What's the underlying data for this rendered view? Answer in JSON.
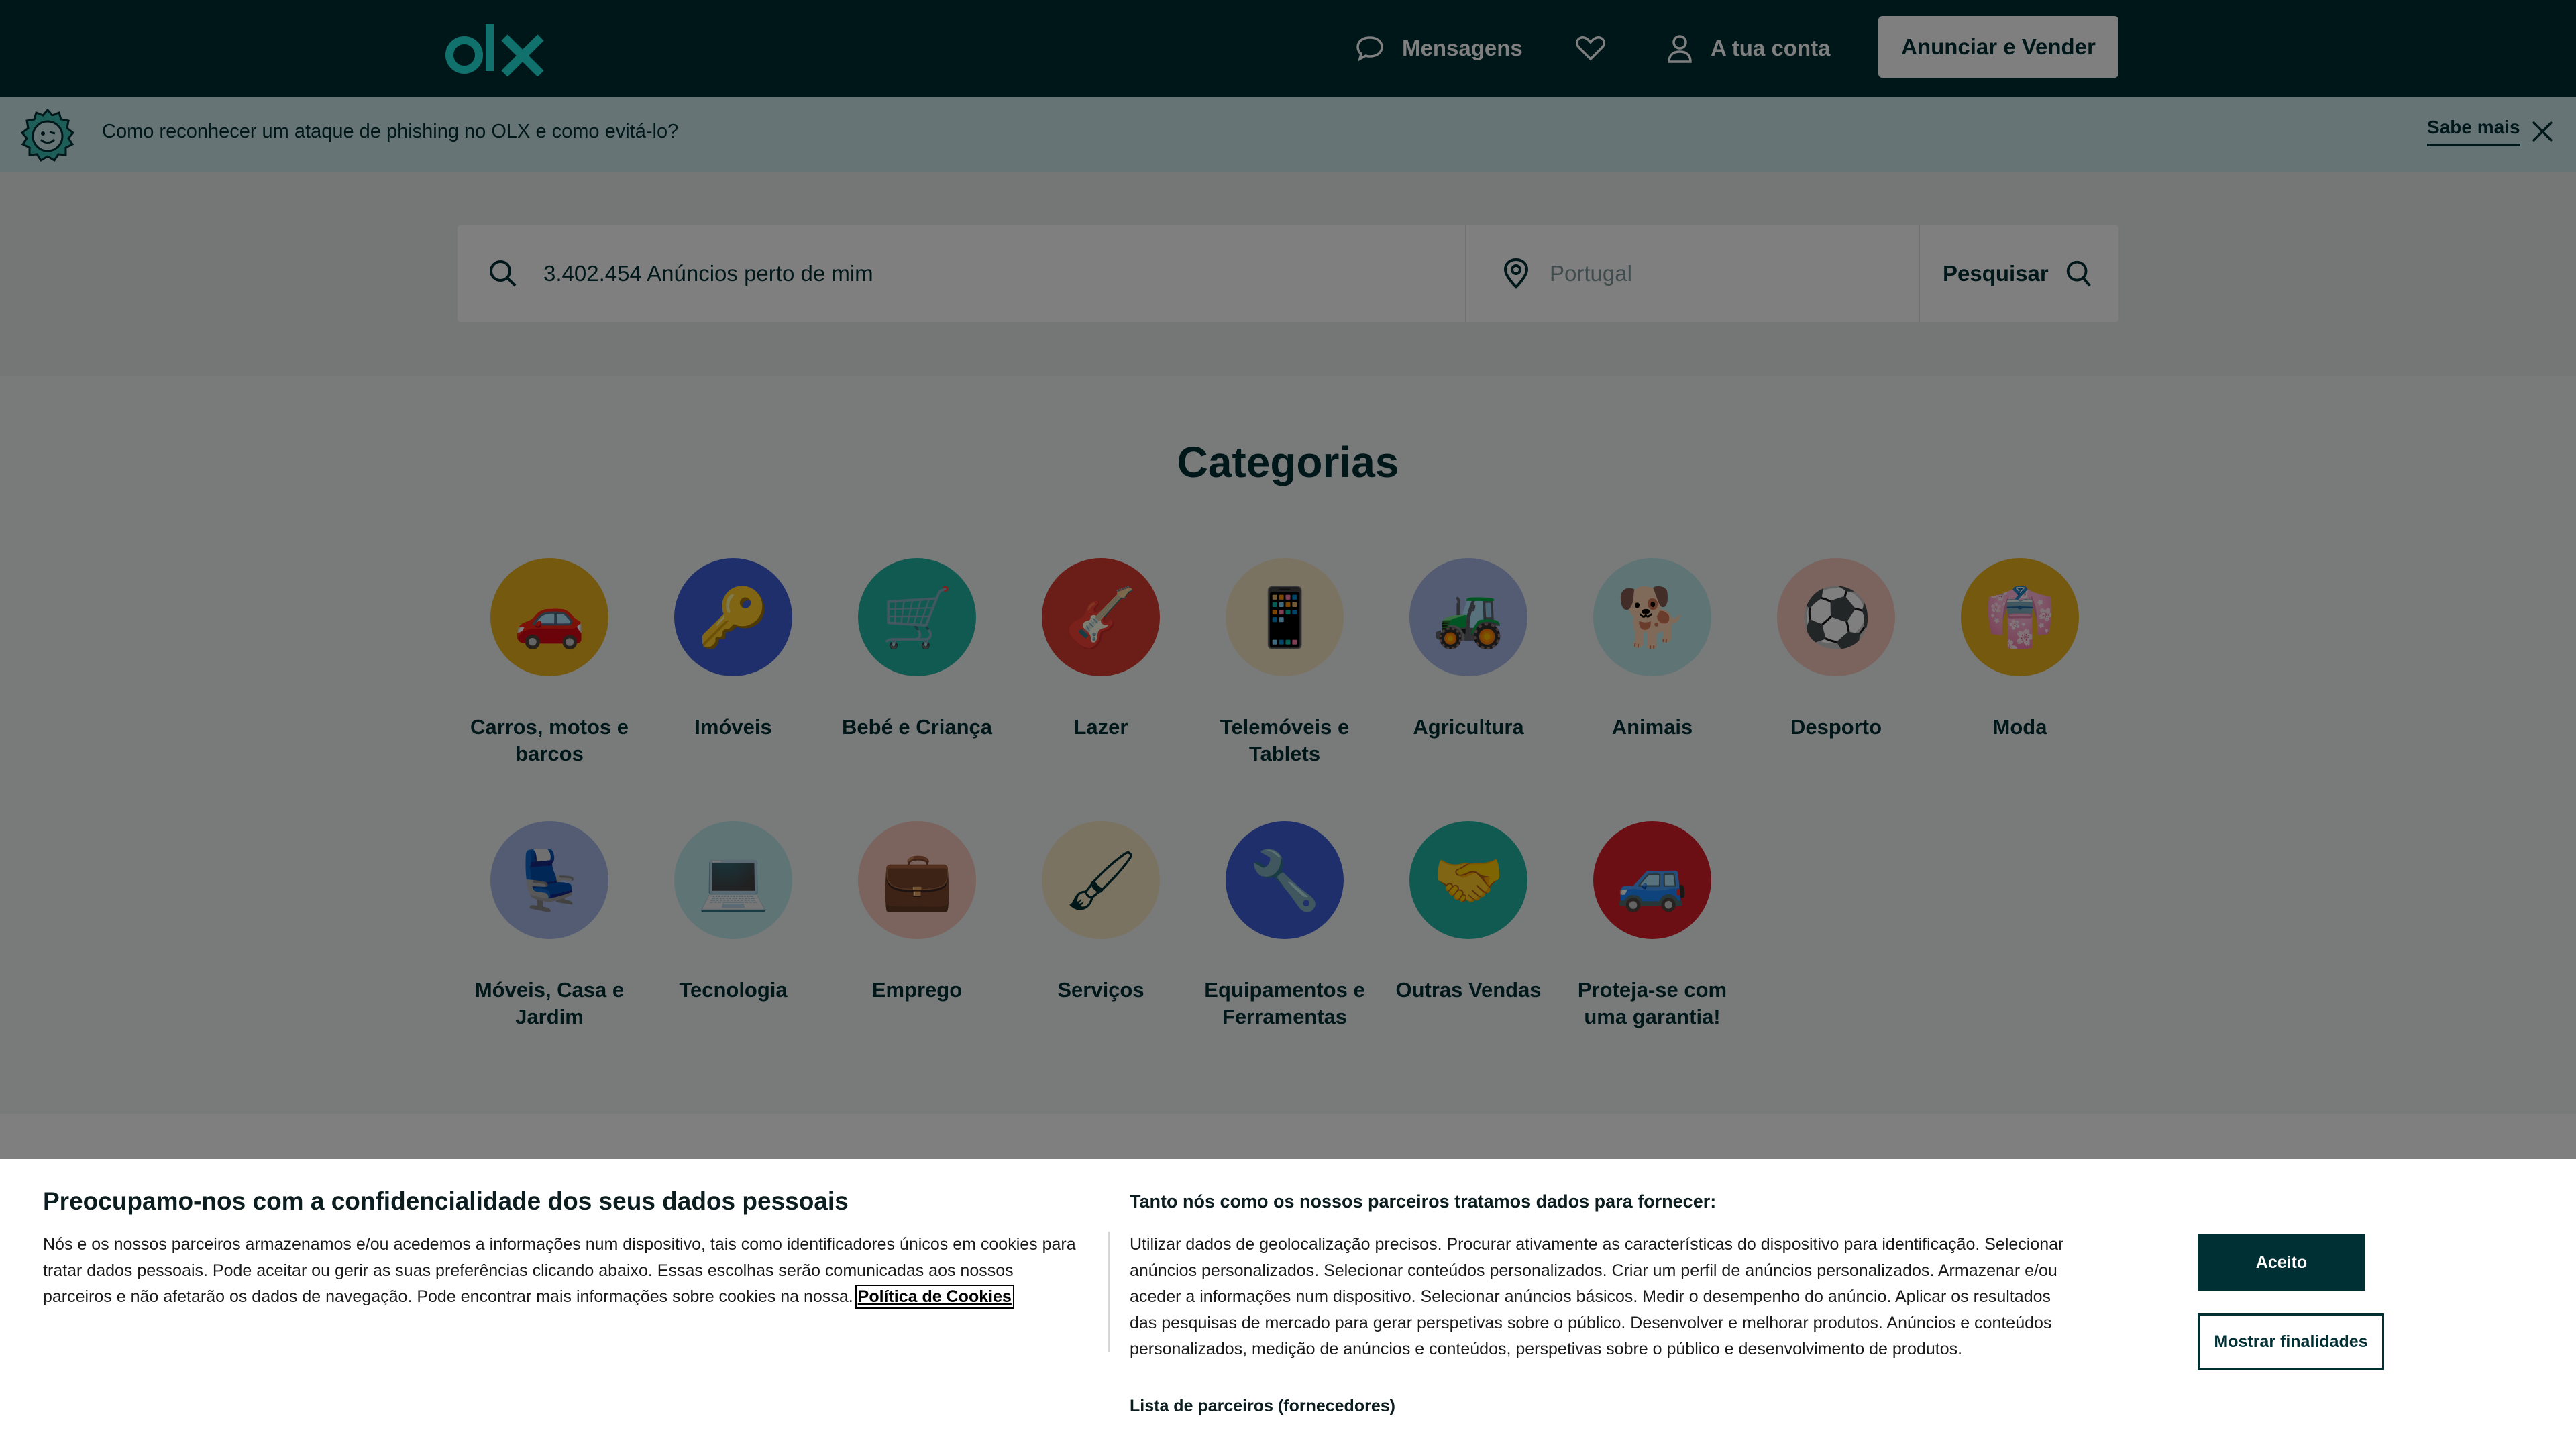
{
  "header": {
    "messages_label": "Mensagens",
    "account_label": "A tua conta",
    "sell_button": "Anunciar e Vender"
  },
  "banner": {
    "text": "Como reconhecer um ataque de phishing no OLX e como evitá-lo?",
    "more_link": "Sabe mais"
  },
  "search": {
    "placeholder": "3.402.454 Anúncios perto de mim",
    "location": "Portugal",
    "button": "Pesquisar"
  },
  "categories": {
    "title": "Categorias",
    "items": [
      {
        "label": "Carros, motos e barcos",
        "color": "#e9b21f"
      },
      {
        "label": "Imóveis",
        "color": "#3e5fd6"
      },
      {
        "label": "Bebé e Criança",
        "color": "#22b5a3"
      },
      {
        "label": "Lazer",
        "color": "#d73a2e"
      },
      {
        "label": "Telemóveis e Tablets",
        "color": "#f6e7c4"
      },
      {
        "label": "Agricultura",
        "color": "#a9b9e6"
      },
      {
        "label": "Animais",
        "color": "#bde8ea"
      },
      {
        "label": "Desporto",
        "color": "#f7c7bd"
      },
      {
        "label": "Moda",
        "color": "#e9b21f"
      },
      {
        "label": "Móveis, Casa e Jardim",
        "color": "#a9b9e6"
      },
      {
        "label": "Tecnologia",
        "color": "#bde8ea"
      },
      {
        "label": "Emprego",
        "color": "#f7c7bd"
      },
      {
        "label": "Serviços",
        "color": "#f6e7c4"
      },
      {
        "label": "Equipamentos e Ferramentas",
        "color": "#3e5fd6"
      },
      {
        "label": "Outras Vendas",
        "color": "#22b5a3"
      },
      {
        "label": "Proteja-se com uma garantia!",
        "color": "#d81f2a"
      }
    ]
  },
  "cookie": {
    "title": "Preocupamo-nos com a confidencialidade dos seus dados pessoais",
    "body": "Nós e os nossos parceiros armazenamos e/ou acedemos a informações num dispositivo, tais como identificadores únicos em cookies para tratar dados pessoais. Pode aceitar ou gerir as suas preferências clicando abaixo. Essas escolhas serão comunicadas aos nossos parceiros e não afetarão os dados de navegação. Pode encontrar mais informações sobre cookies na nossa.",
    "policy_link": "Política de Cookies",
    "right_title": "Tanto nós como os nossos parceiros tratamos dados para fornecer:",
    "right_body": "Utilizar dados de geolocalização precisos. Procurar ativamente as características do dispositivo para identificação. Selecionar anúncios personalizados. Selecionar conteúdos personalizados. Criar um perfil de anúncios personalizados. Armazenar e/ou aceder a informações num dispositivo. Selecionar anúncios básicos. Medir o desempenho do anúncio. Aplicar os resultados das pesquisas de mercado para gerar perspetivas sobre o público. Desenvolver e melhorar produtos. Anúncios e conteúdos personalizados, medição de anúncios e conteúdos, perspetivas sobre o público e desenvolvimento de produtos.",
    "partners_link": "Lista de parceiros (fornecedores)",
    "accept_button": "Aceito",
    "purposes_button": "Mostrar finalidades"
  },
  "colors": {
    "brand_dark": "#002f34",
    "brand_teal": "#23e5db",
    "banner_bg": "#cde8ec"
  }
}
